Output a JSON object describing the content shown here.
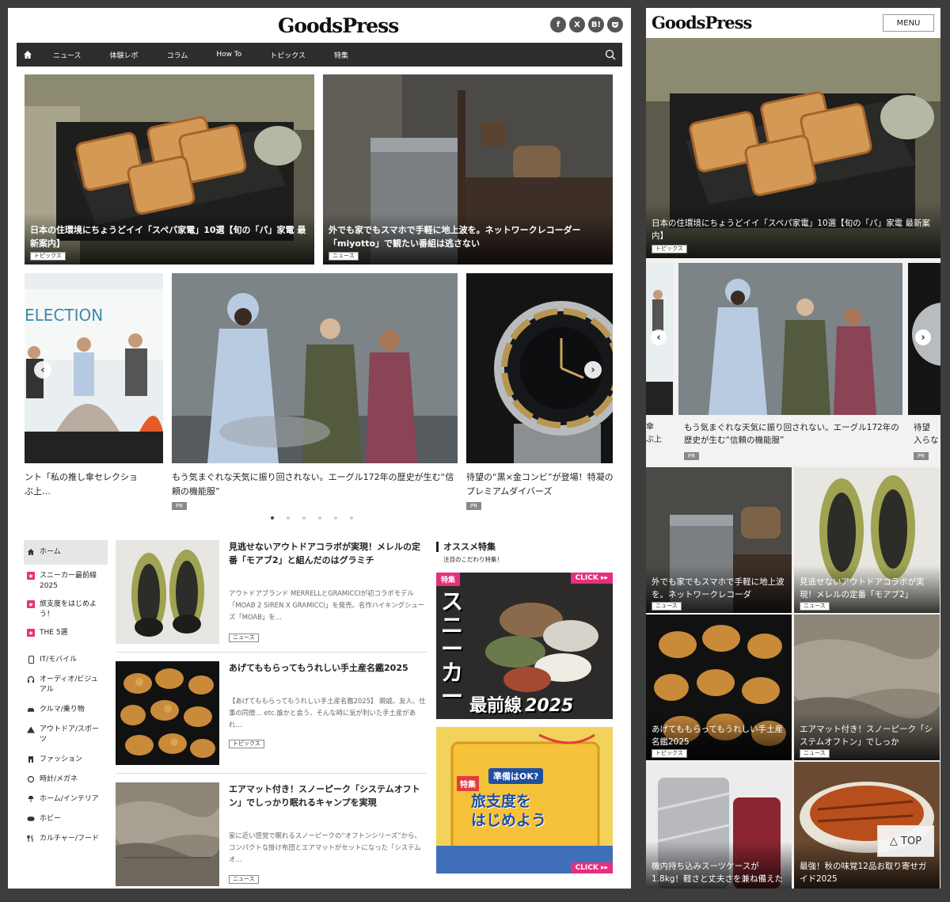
{
  "site": {
    "logo": "GoodsPress"
  },
  "social": [
    {
      "label": "f",
      "icon": "facebook-icon"
    },
    {
      "label": "X",
      "icon": "x-icon"
    },
    {
      "label": "B!",
      "icon": "hatena-bookmark-icon"
    },
    {
      "label": "P",
      "icon": "pocket-icon"
    }
  ],
  "nav": {
    "items": [
      "ニュース",
      "体験レポ",
      "コラム",
      "How To",
      "トピックス",
      "特集"
    ]
  },
  "hero": [
    {
      "title": "日本の住環境にちょうどイイ「スペパ家電」10選【旬の「パ」家電 最新案内】",
      "tag": "トピックス"
    },
    {
      "title": "外でも家でもスマホで手軽に地上波を。ネットワークレコーダー「miyotto」で観たい番組は逃さない",
      "tag": "ニュース"
    }
  ],
  "carousel": [
    {
      "title": "ント「私の推し傘セレクショ",
      "title2": "ぶ上…"
    },
    {
      "title": "もう気まぐれな天気に振り回されない。エーグル172年の歴史が生む“信頼の機能服”",
      "tag": "PR"
    },
    {
      "title": "待望の“黒×金コンビ”が登場！特凝のプレミアムダイバーズ",
      "tag": "PR"
    }
  ],
  "sidebar": [
    {
      "label": "ホーム",
      "icon": "home-icon",
      "active": true
    },
    {
      "label": "スニーカー最前線2025",
      "icon": "feature-bookmark-icon"
    },
    {
      "label": "旅支度をはじめよう！",
      "icon": "feature-bookmark-icon"
    },
    {
      "label": "THE 5選",
      "icon": "feature-bookmark-icon"
    },
    {
      "label": "IT/モバイル",
      "icon": "smartphone-icon"
    },
    {
      "label": "オーディオ/ビジュアル",
      "icon": "headphones-icon"
    },
    {
      "label": "クルマ/乗り物",
      "icon": "car-icon"
    },
    {
      "label": "アウトドア/スポーツ",
      "icon": "tent-icon"
    },
    {
      "label": "ファッション",
      "icon": "fashion-icon"
    },
    {
      "label": "時計/メガネ",
      "icon": "watch-icon"
    },
    {
      "label": "ホーム/インテリア",
      "icon": "lamp-icon"
    },
    {
      "label": "ホビー",
      "icon": "gamepad-icon"
    },
    {
      "label": "カルチャー/フード",
      "icon": "utensils-icon"
    }
  ],
  "articles": [
    {
      "title": "見逃せないアウトドアコラボが実現！メレルの定番「モアブ2」と組んだのはグラミチ",
      "desc": "アウトドアブランド MERRELLとGRAMICCIが初コラボモデル「MOAB 2 SIREN X GRAMICCI」を発売。名作ハイキングシューズ「MOAB」を…",
      "tag": "ニュース"
    },
    {
      "title": "あげてももらってもうれしい手土産名鑑2025",
      "desc": "【あげてももらってもうれしい手土産名鑑2025】 親戚、友人、仕事の同僚… etc.誰かと会う、そんな時に気が利いた手土産があれ…",
      "tag": "トピックス"
    },
    {
      "title": "エアマット付き！スノーピーク「システムオフトン」でしっかり眠れるキャンプを実現",
      "desc": "家に近い感覚で眠れるスノーピークの“オフトンシリーズ”から、コンパクトな掛け布団とエアマットがセットになった「システムオ…",
      "tag": "ニュース"
    }
  ],
  "recommended": {
    "title": "オススメ特集",
    "subtitle": "注目のこだわり特集！",
    "banners": [
      {
        "badge": "特集",
        "click": "CLICK ▸▸",
        "big": "スニーカー",
        "big2": "最前線",
        "year": "2025"
      },
      {
        "badge": "特集",
        "ribbon": "準備はOK?",
        "big": "旅支度を",
        "big2": "はじめよう",
        "click": "CLICK ▸▸"
      }
    ]
  },
  "mobile": {
    "menu": "MENU",
    "hero": {
      "title": "日本の住環境にちょうどイイ「スペパ家電」10選【旬の「パ」家電 最新案内】",
      "tag": "トピックス"
    },
    "carousel": [
      {
        "title": "傘",
        "title2": "ぶ上"
      },
      {
        "title": "もう気まぐれな天気に振り回されない。エーグル172年の歴史が生む“信頼の機能服”",
        "tag": "PR"
      },
      {
        "title": "待望",
        "title2": "入らな",
        "tag": "PR"
      }
    ],
    "tiles": [
      {
        "title": "外でも家でもスマホで手軽に地上波を。ネットワークレコーダ",
        "tag": "ニュース"
      },
      {
        "title": "見逃せないアウトドアコラボが実現！メレルの定番「モアブ2」",
        "tag": "ニュース"
      },
      {
        "title": "あげてももらってもうれしい手土産名鑑2025",
        "tag": "トピックス"
      },
      {
        "title": "エアマット付き！スノーピーク「システムオフトン」でしっか",
        "tag": "ニュース"
      },
      {
        "title": "機内持ち込みスーツケースが1.8kg！軽さと丈夫さを兼ね備えた"
      },
      {
        "title": "最強！秋の味覚12品お取り寄せガイド2025"
      }
    ],
    "top": "△ TOP"
  }
}
